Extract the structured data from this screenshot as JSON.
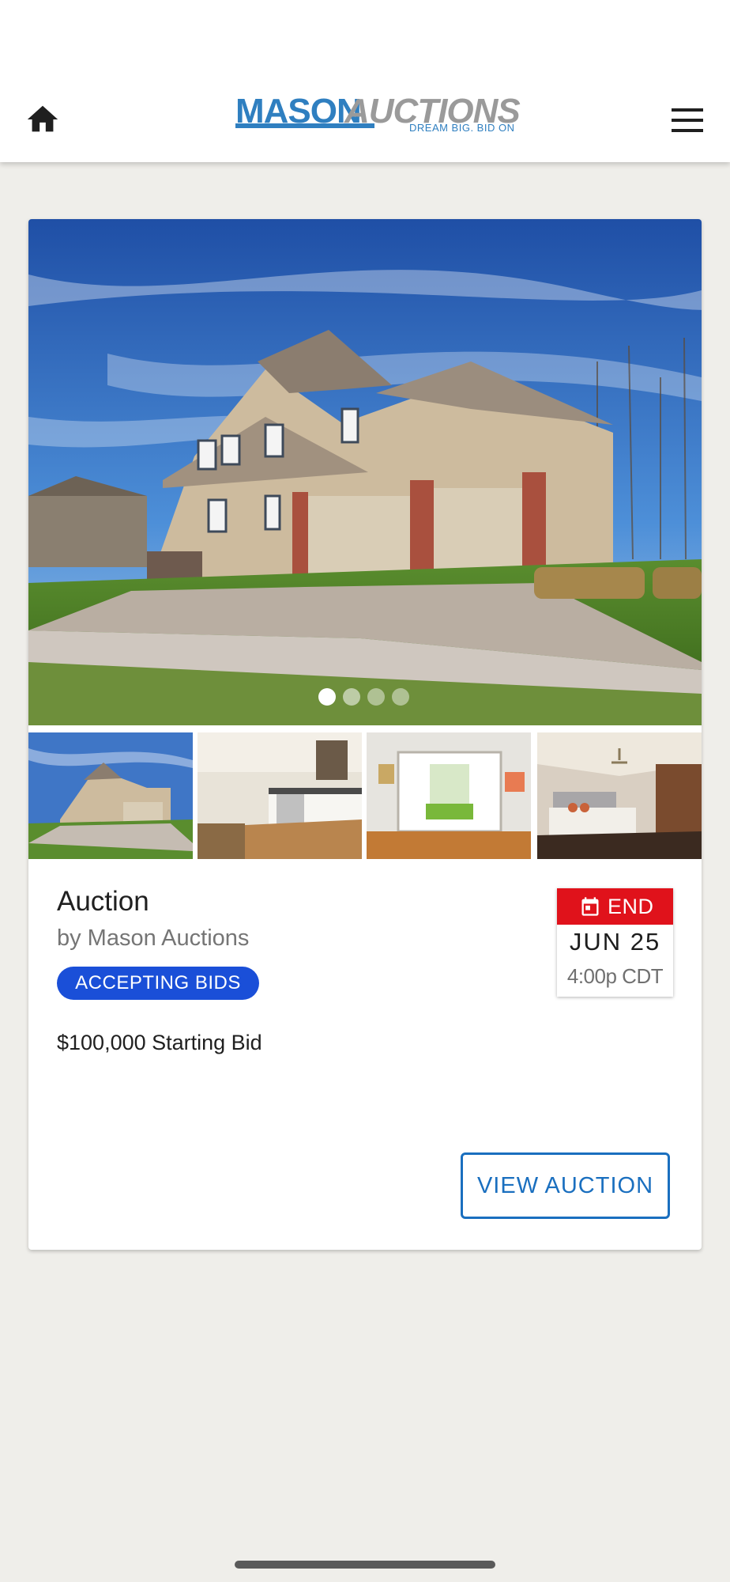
{
  "header": {
    "logo_primary": "MASON",
    "logo_secondary": "AUCTIONS",
    "logo_tagline": "DREAM BIG. BID ON",
    "home_icon": "home-icon",
    "menu_icon": "menu-icon"
  },
  "carousel": {
    "slide_count": 4,
    "active_slide": 1,
    "photos": [
      "house-exterior",
      "kitchen",
      "living-room",
      "bedroom"
    ]
  },
  "listing": {
    "title": "Auction",
    "byline": "by Mason Auctions",
    "status": "ACCEPTING BIDS",
    "price": "$100,000 Starting Bid",
    "end": {
      "label": "END",
      "date": "JUN 25",
      "time": "4:00p CDT",
      "icon": "calendar-icon"
    },
    "view_button": "VIEW AUCTION"
  },
  "colors": {
    "brand_blue": "#2f7fc0",
    "status_blue": "#1a4fd8",
    "end_red": "#e0121b",
    "button_blue": "#1a6fbf",
    "background": "#efeeea"
  }
}
